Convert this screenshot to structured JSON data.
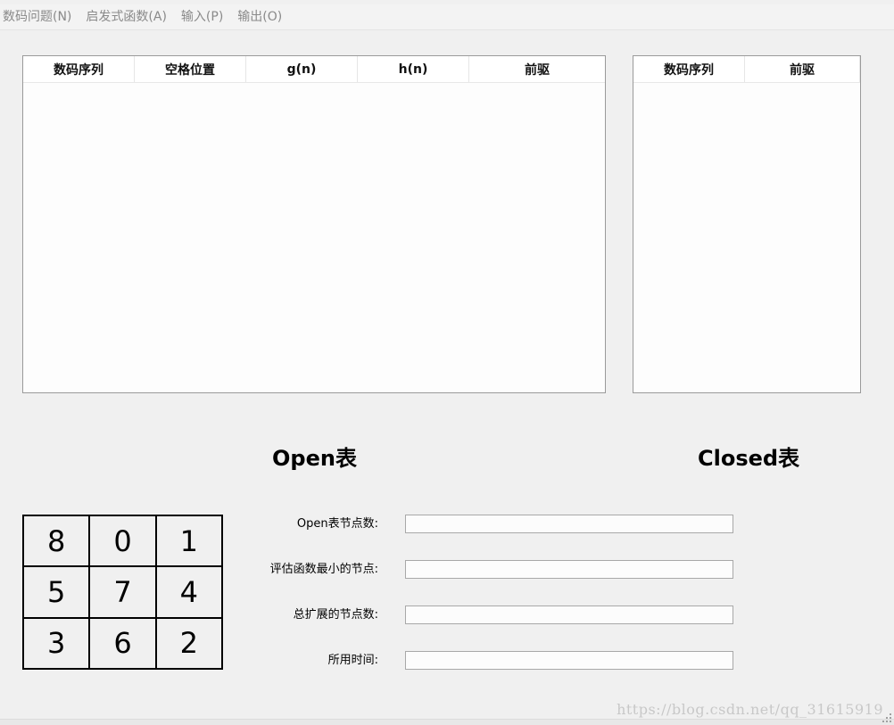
{
  "menu": {
    "items": [
      {
        "label": "数码问题(N)"
      },
      {
        "label": "启发式函数(A)"
      },
      {
        "label": "输入(P)"
      },
      {
        "label": "输出(O)"
      }
    ]
  },
  "open_table": {
    "caption": "Open表",
    "columns": [
      "数码序列",
      "空格位置",
      "g(n)",
      "h(n)",
      "前驱"
    ],
    "rows": []
  },
  "closed_table": {
    "caption": "Closed表",
    "columns": [
      "数码序列",
      "前驱"
    ],
    "rows": []
  },
  "board": {
    "tiles": [
      "8",
      "0",
      "1",
      "5",
      "7",
      "4",
      "3",
      "6",
      "2"
    ]
  },
  "stats": {
    "open_count_label": "Open表节点数:",
    "open_count_value": "",
    "min_eval_label": "评估函数最小的节点:",
    "min_eval_value": "",
    "expanded_label": "总扩展的节点数:",
    "expanded_value": "",
    "time_label": "所用时间:",
    "time_value": ""
  },
  "watermark": "https://blog.csdn.net/qq_31615919"
}
